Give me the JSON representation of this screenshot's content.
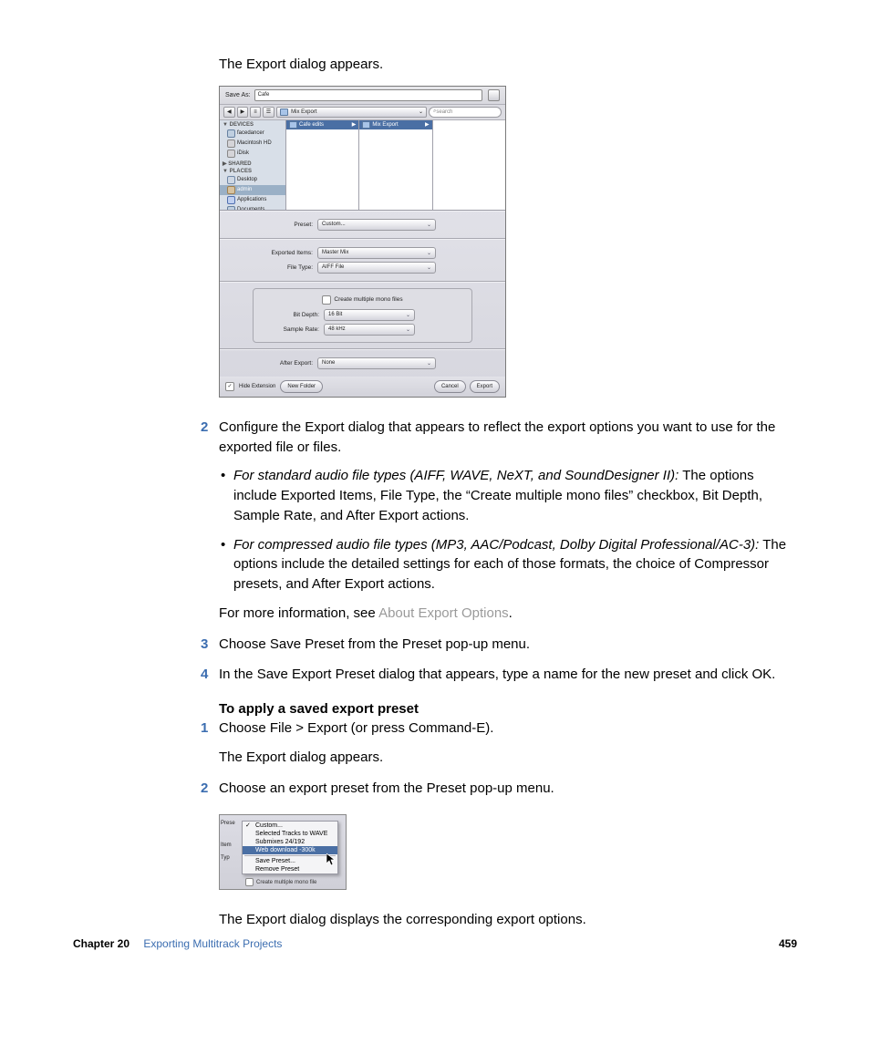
{
  "intro_line": "The Export dialog appears.",
  "dialog": {
    "save_as_label": "Save As:",
    "save_as_value": "Cafe",
    "path_current": "Mix Export",
    "search_placeholder": "search",
    "nav": {
      "back": "◀",
      "fwd": "▶",
      "view": "≡",
      "list": "☰"
    },
    "sidebar": {
      "devices_label": "▼ DEVICES",
      "devices": [
        "facedancer",
        "Macintosh HD",
        "iDisk"
      ],
      "shared_label": "▶ SHARED",
      "places_label": "▼ PLACES",
      "places": [
        "Desktop",
        "admin",
        "Applications",
        "Documents"
      ]
    },
    "col1_item": "Cafe edits",
    "col2_item": "Mix Export",
    "rows": {
      "preset_label": "Preset:",
      "preset_value": "Custom...",
      "exported_label": "Exported Items:",
      "exported_value": "Master Mix",
      "filetype_label": "File Type:",
      "filetype_value": "AIFF File",
      "checkbox_label": "Create multiple mono files",
      "bitdepth_label": "Bit Depth:",
      "bitdepth_value": "16 Bit",
      "samplerate_label": "Sample Rate:",
      "samplerate_value": "48 kHz",
      "after_label": "After Export:",
      "after_value": "None"
    },
    "bottom": {
      "hide_ext": "Hide Extension",
      "new_folder": "New Folder",
      "cancel": "Cancel",
      "export": "Export"
    }
  },
  "step2_main": "Configure the Export dialog that appears to reflect the export options you want to use for the exported file or files.",
  "step2_bullet1_em": "For standard audio file types (AIFF, WAVE, NeXT, and SoundDesigner II):",
  "step2_bullet1_rest": " The options include Exported Items, File Type, the “Create multiple mono files” checkbox, Bit Depth, Sample Rate, and After Export actions.",
  "step2_bullet2_em": "For compressed audio file types (MP3, AAC/Podcast, Dolby Digital Professional/AC-3):",
  "step2_bullet2_rest": " The options include the detailed settings for each of those formats, the choice of Compressor presets, and After Export actions.",
  "step2_more_pre": "For more information, see ",
  "step2_more_link": "About Export Options",
  "step2_more_post": ".",
  "step3": "Choose Save Preset from the Preset pop-up menu.",
  "step4": "In the Save Export Preset dialog that appears, type a name for the new preset and click OK.",
  "apply_heading": "To apply a saved export preset",
  "apply_step1": "Choose File > Export (or press Command-E).",
  "apply_step1_after": "The Export dialog appears.",
  "apply_step2": "Choose an export preset from the Preset pop-up menu.",
  "preset_menu": {
    "labels": {
      "preset": "Prese",
      "items": "Item",
      "type": "  Typ"
    },
    "items": [
      "Custom...",
      "Selected Tracks to WAVE",
      "Submixes 24/192",
      "Web download -300k"
    ],
    "save": "Save Preset...",
    "remove": "Remove Preset",
    "footer_checkbox": "Create multiple mono file"
  },
  "after_preset": "The Export dialog displays the corresponding export options.",
  "footer": {
    "chapter_label": "Chapter 20",
    "chapter_title": "Exporting Multitrack Projects",
    "page": "459"
  },
  "step_nums": {
    "s2": "2",
    "s3": "3",
    "s4": "4",
    "a1": "1",
    "a2": "2"
  }
}
